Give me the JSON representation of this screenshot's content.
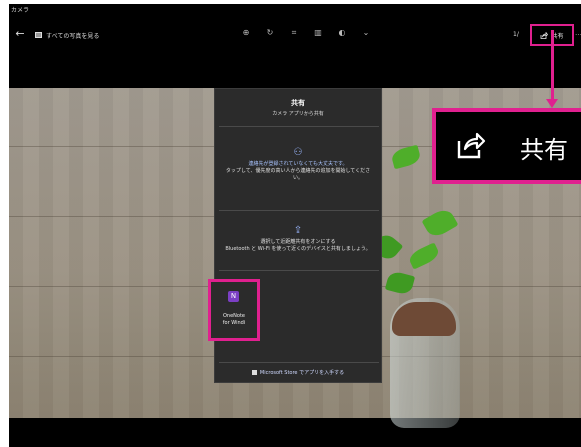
{
  "window": {
    "app_title": "カメラ"
  },
  "toolbar": {
    "back_glyph": "←",
    "all_photos_label": "すべての写真を見る",
    "icons": [
      "zoom-in-icon",
      "rotate-icon",
      "crop-icon",
      "delete-icon",
      "edit-icon",
      "chevron-down-icon"
    ],
    "counter": "1/",
    "share_label": "共有",
    "more_glyph": "…"
  },
  "share_panel": {
    "title": "共有",
    "subtitle": "カメラ アプリから共有",
    "contacts": {
      "headline": "連絡先が登録されていなくても大丈夫です。",
      "body": "タップして、優先度の高い人から連絡先の追加を開始してください。"
    },
    "nearby": {
      "headline": "選択して近距離共有をオンにする",
      "body": "Bluetooth と Wi-Fi を使って近くのデバイスと共有しましょう。"
    },
    "app_tile": {
      "icon_letter": "N",
      "line1": "OneNote",
      "line2": "for Windi"
    },
    "store_link": "Microsoft Store でアプリを入手する"
  },
  "callout": {
    "label": "共有"
  },
  "colors": {
    "highlight": "#e0208f",
    "panel_bg": "#2b2b2b",
    "accent_text": "#a9c4ff"
  }
}
